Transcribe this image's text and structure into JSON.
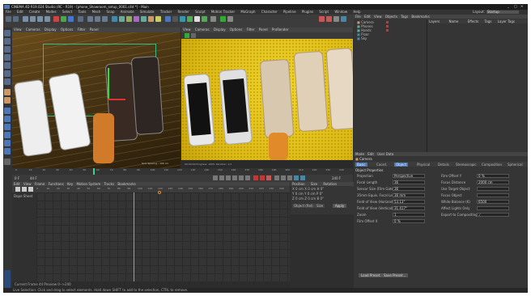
{
  "window": {
    "title": "CINEMA 4D R19.024 Studio (RC - R19) - [phone_Showroom_setup_0001.c4d *] - Main",
    "controls": [
      "_",
      "□",
      "✕"
    ]
  },
  "menu": [
    "File",
    "Edit",
    "Create",
    "Modes",
    "Select",
    "Tools",
    "Mesh",
    "Snap",
    "Animate",
    "Simulate",
    "Tracker",
    "Render",
    "Sculpt",
    "Motion Tracker",
    "MoGraph",
    "Character",
    "Pipeline",
    "Plugins",
    "Script",
    "Window",
    "Help"
  ],
  "layout_label": "Layout:",
  "layout_value": "Startup",
  "viewport_left": {
    "menu": [
      "View",
      "Cameras",
      "Display",
      "Options",
      "Filter",
      "Panel"
    ],
    "label": "Perspective",
    "readout": "Grid Spacing : 100 cm"
  },
  "viewport_right": {
    "menu": [
      "View",
      "Cameras",
      "Display",
      "Options",
      "Filter",
      "Panel",
      "ProRender"
    ],
    "readout": "00:00:00  Progress: 100%  Iteration: 1/1"
  },
  "objects_panel": {
    "menu": [
      "File",
      "Edit",
      "View",
      "Objects",
      "Tags",
      "Bookmarks"
    ],
    "items": [
      "Camera",
      "Phones",
      "Hands",
      "Floor",
      "Sky"
    ]
  },
  "layers_header": [
    "Layers",
    "Name",
    "Effects",
    "Tags",
    "Layer Tags"
  ],
  "timeline": {
    "ticks": [
      "0",
      "10",
      "20",
      "30",
      "40",
      "50",
      "60",
      "70",
      "80",
      "90",
      "100",
      "110",
      "120",
      "130",
      "140",
      "150",
      "160",
      "170",
      "180",
      "190",
      "200",
      "210",
      "220",
      "230",
      "240"
    ],
    "start": "0 F",
    "end": "240 F",
    "current": "44 F"
  },
  "dopesheet": {
    "menu": [
      "Edit",
      "View",
      "Frame",
      "Functions",
      "Key",
      "Motion System",
      "Tracks",
      "Bookmarks"
    ],
    "side_label": "Dope Sheet",
    "footer": "Current Frame  44  Preview  0-->240"
  },
  "coords": {
    "header": [
      "Position",
      "Size",
      "Rotation"
    ],
    "rows": [
      [
        "X",
        "0 cm",
        "X",
        "0 cm",
        "H",
        "0°"
      ],
      [
        "Y",
        "0 cm",
        "Y",
        "0 cm",
        "P",
        "0°"
      ],
      [
        "Z",
        "0 cm",
        "Z",
        "0 cm",
        "B",
        "0°"
      ]
    ],
    "object_dropdown": "Object (Rel)",
    "size_dropdown": "Size",
    "apply": "Apply"
  },
  "attributes": {
    "menu": [
      "Mode",
      "Edit",
      "User Data"
    ],
    "object": "Camera",
    "tabs": [
      "Basic",
      "Coord.",
      "Object",
      "Physical",
      "Details",
      "Stereoscopic",
      "Composition",
      "Spherical"
    ],
    "section": "Object Properties",
    "fields": [
      {
        "label": "Projection",
        "value": "Perspective"
      },
      {
        "label": "Focal Length",
        "value": "36"
      },
      {
        "label": "Sensor Size (Film Gate)",
        "value": "36"
      },
      {
        "label": "35mm Equiv. Focal Length",
        "value": "36 mm"
      },
      {
        "label": "Field of View (Horizontal)",
        "value": "53.13°"
      },
      {
        "label": "Field of View (Vertical)",
        "value": "31.417°"
      },
      {
        "label": "Zoom",
        "value": "1"
      },
      {
        "label": "Film Offset X",
        "value": "0 %"
      },
      {
        "label": "Film Offset Y",
        "value": "0 %"
      },
      {
        "label": "Focus Distance",
        "value": "2000 cm"
      },
      {
        "label": "Use Target Object",
        "value": ""
      },
      {
        "label": "Focus Object",
        "value": ""
      },
      {
        "label": "White Balance (K)",
        "value": "6500"
      },
      {
        "label": "Affect Lights Only",
        "value": ""
      },
      {
        "label": "Export to Compositing",
        "value": "✓"
      }
    ],
    "buttons": [
      "Load Preset...",
      "Save Preset..."
    ]
  },
  "status": "Live Selection: Click and drag to select elements. Hold down SHIFT to add to the selection, CTRL to remove.",
  "colors": {
    "accent_blue": "#4a78b8",
    "render_yellow": "#e6c51e",
    "timeline_green": "#39d18e",
    "key_orange": "#e08a2a"
  }
}
